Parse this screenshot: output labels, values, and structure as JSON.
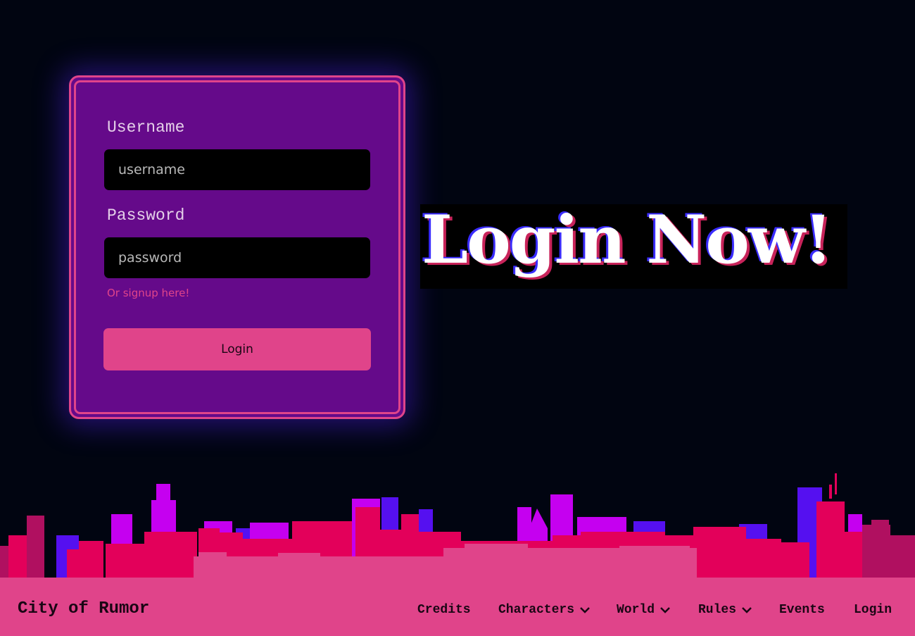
{
  "login": {
    "username_label": "Username",
    "username_placeholder": "username",
    "password_label": "Password",
    "password_placeholder": "password",
    "signup_link": "Or signup here!",
    "login_button": "Login"
  },
  "banner": {
    "text": "Login Now!"
  },
  "footer": {
    "brand": "City of Rumor",
    "nav": [
      {
        "label": "Credits",
        "icon": ""
      },
      {
        "label": "Characters",
        "icon": "chevron-down-icon"
      },
      {
        "label": "World",
        "icon": "chevron-down-icon"
      },
      {
        "label": "Rules",
        "icon": "chevron-down-icon"
      },
      {
        "label": "Events",
        "icon": ""
      },
      {
        "label": "Login",
        "icon": ""
      }
    ]
  },
  "colors": {
    "background": "#010511",
    "card": "#650a8a",
    "accent_pink": "#e0448a",
    "skyline_red": "#e3005a",
    "skyline_magenta": "#c500f0",
    "skyline_blue": "#5510f0"
  }
}
